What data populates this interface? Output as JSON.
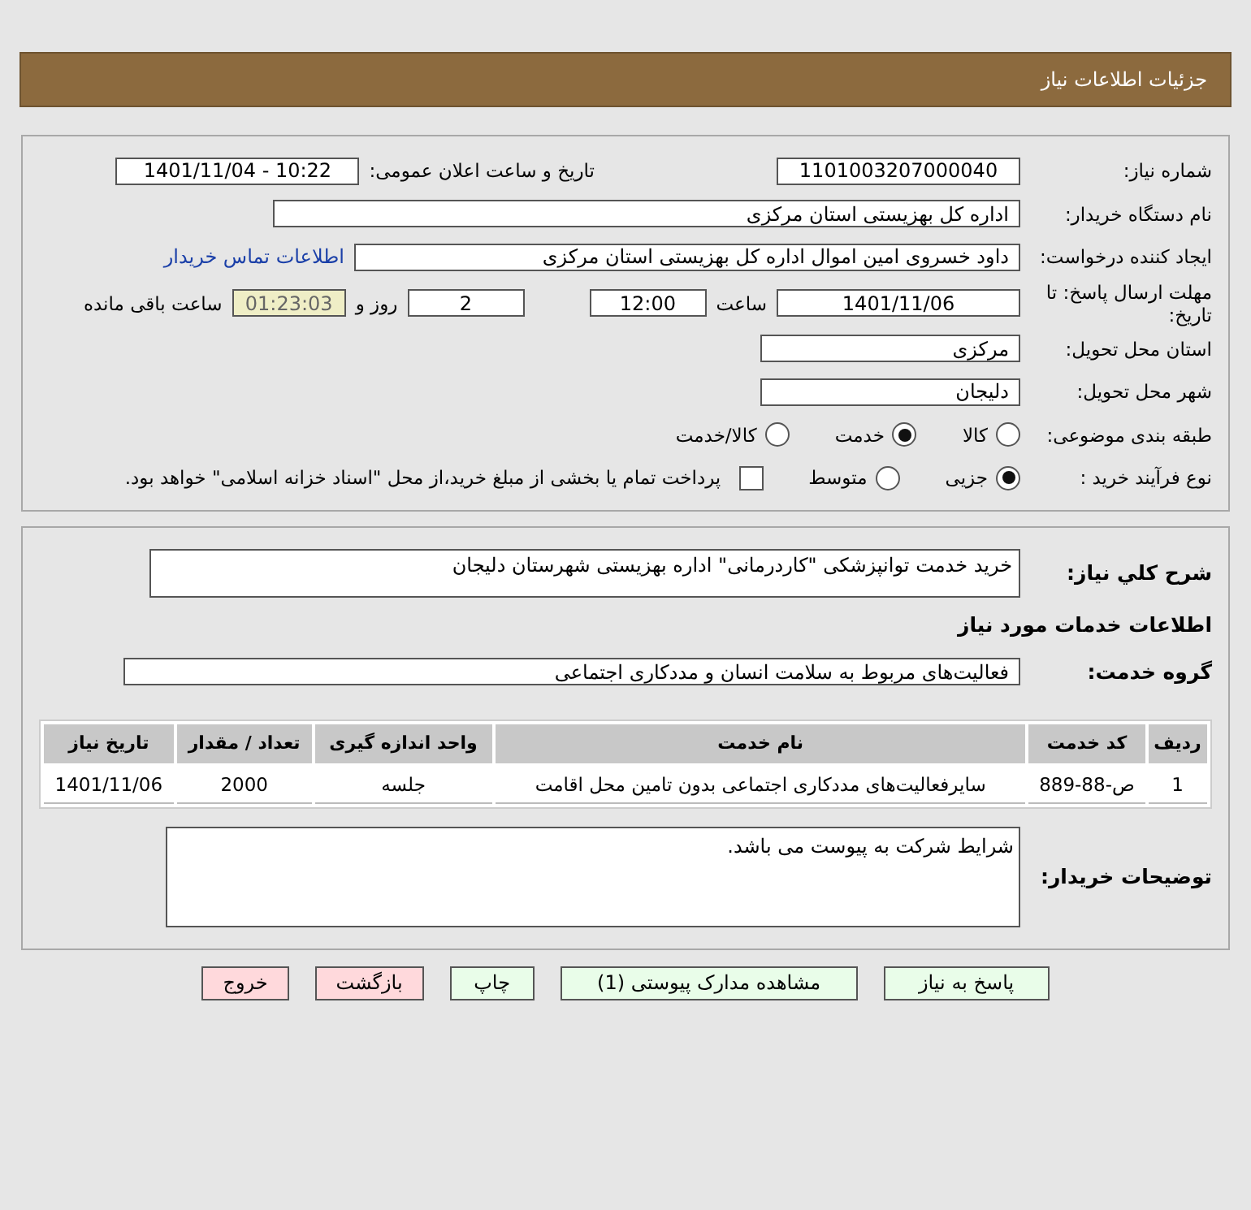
{
  "header": {
    "title": "جزئیات اطلاعات نیاز"
  },
  "need_number": {
    "label": "شماره نیاز:",
    "value": "1101003207000040"
  },
  "announce": {
    "label": "تاریخ و ساعت اعلان عمومی:",
    "value": "1401/11/04 - 10:22"
  },
  "buyer_org": {
    "label": "نام دستگاه خریدار:",
    "value": "اداره کل بهزیستی استان مرکزی"
  },
  "creator": {
    "label": "ایجاد کننده درخواست:",
    "value": "داود خسروی امین اموال اداره کل بهزیستی استان مرکزی",
    "contact_link": "اطلاعات تماس خریدار"
  },
  "deadline": {
    "label": "مهلت ارسال پاسخ: تا تاریخ:",
    "date": "1401/11/06",
    "time_label": "ساعت",
    "time": "12:00",
    "days": "2",
    "days_label": "روز و",
    "remaining": "01:23:03",
    "remaining_label": "ساعت باقی مانده"
  },
  "province": {
    "label": "استان محل تحویل:",
    "value": "مرکزی"
  },
  "city": {
    "label": "شهر محل تحویل:",
    "value": "دلیجان"
  },
  "category": {
    "label": "طبقه بندی موضوعی:",
    "options": [
      {
        "label": "کالا",
        "selected": false
      },
      {
        "label": "خدمت",
        "selected": true
      },
      {
        "label": "کالا/خدمت",
        "selected": false
      }
    ]
  },
  "process": {
    "label": "نوع فرآیند خرید :",
    "options": [
      {
        "label": "جزیی",
        "selected": true
      },
      {
        "label": "متوسط",
        "selected": false
      }
    ],
    "treasury": {
      "checked": false,
      "text": "پرداخت تمام یا بخشی از مبلغ خرید،از محل \"اسناد خزانه اسلامی\" خواهد بود."
    }
  },
  "description": {
    "label": "شرح کلي نياز:",
    "value": "خرید خدمت توانپزشکی \"کاردرمانی\" اداره بهزیستی شهرستان دلیجان"
  },
  "services_title": "اطلاعات خدمات مورد نیاز",
  "service_group": {
    "label": "گروه خدمت:",
    "value": "فعالیت‌های مربوط به سلامت انسان و مددکاری اجتماعی"
  },
  "table": {
    "columns": [
      "ردیف",
      "کد خدمت",
      "نام خدمت",
      "واحد اندازه گیری",
      "تعداد / مقدار",
      "تاریخ نیاز"
    ],
    "rows": [
      [
        "1",
        "ص-88-889",
        "سایرفعالیت‌های مددکاری اجتماعی بدون تامین محل اقامت",
        "جلسه",
        "2000",
        "1401/11/06"
      ]
    ]
  },
  "buyer_notes": {
    "label": "توضیحات خریدار:",
    "value": "شرایط شرکت به پیوست می باشد."
  },
  "buttons": [
    {
      "label": "پاسخ به نیاز",
      "kind": "normal"
    },
    {
      "label": "مشاهده مدارک پیوستی (1)",
      "kind": "normal"
    },
    {
      "label": "چاپ",
      "kind": "normal"
    },
    {
      "label": "بازگشت",
      "kind": "danger"
    },
    {
      "label": "خروج",
      "kind": "danger"
    }
  ]
}
